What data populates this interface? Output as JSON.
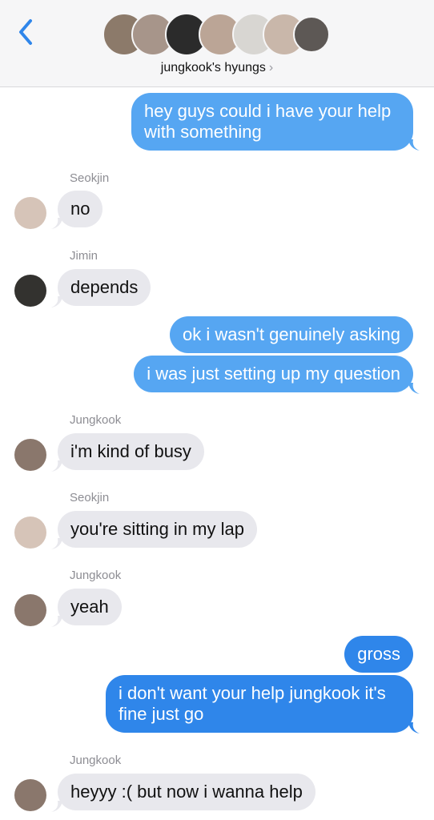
{
  "header": {
    "group_name": "jungkook's hyungs",
    "chevron": "›",
    "back_icon": "chevron-left-icon",
    "avatar_colors": [
      "#8c7a6a",
      "#a7958a",
      "#2b2b2b",
      "#bba596",
      "#d8d6d2",
      "#c9b7aa",
      "#5d5855"
    ]
  },
  "messages": {
    "m1": "hey guys could i have your help",
    "m1b": "with something",
    "s1": "Seokjin",
    "m2": "no",
    "s2": "Jimin",
    "m3": "depends",
    "m4": "ok i wasn't genuinely asking",
    "m5": "i was just setting up my question",
    "s3": "Jungkook",
    "m6": "i'm kind of busy",
    "s4": "Seokjin",
    "m7": "you're sitting in my lap",
    "s5": "Jungkook",
    "m8": "yeah",
    "m9": "gross",
    "m10": "i don't want your help jungkook it's",
    "m10b": "fine just go",
    "s6": "Jungkook",
    "m11": "heyyy :( but now i wanna help"
  },
  "colors": {
    "outgoing": "#2f86ea",
    "outgoing_light": "#56a6f2",
    "incoming": "#e8e8ed",
    "accent": "#2f86ea"
  }
}
